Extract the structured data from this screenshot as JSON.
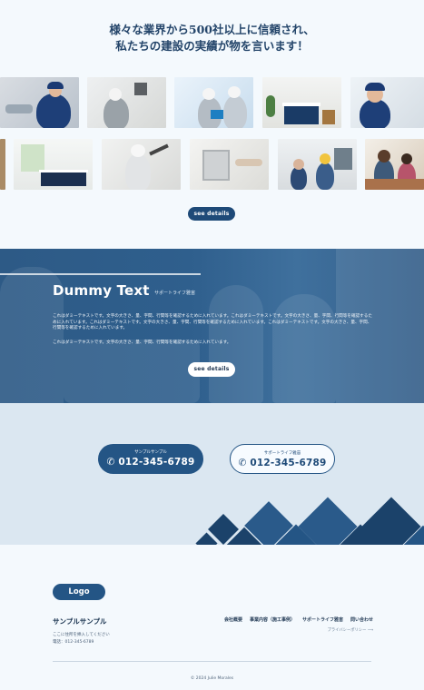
{
  "hero": {
    "headline_line1": "様々な業界から500社以上に信頼され、",
    "headline_line2": "私たちの建設の実績が物を言います！",
    "see_details_label": "see details"
  },
  "band": {
    "title": "Dummy Text",
    "subtitle": "サポートライフ雅宙",
    "paragraph1": "これはダミーテキストです。文字の大きさ、量、字間、行間等を確認するために入れています。これはダミーテキストです。文字の大きさ、量、字間、行間等を確認するために入れています。これはダミーテキストです。文字の大きさ、量、字間、行間等を確認するために入れています。これはダミーテキストです。文字の大きさ、量、字間、行間等を確認するために入れています。",
    "paragraph2": "これはダミーテキストです。文字の大きさ、量、字間、行間等を確認するために入れています。",
    "see_details_label": "see details"
  },
  "phones": {
    "primary": {
      "label": "サンプルサンプル",
      "number": "012-345-6789"
    },
    "secondary": {
      "label": "サポートライフ雅宙",
      "number": "012-345-6789"
    }
  },
  "footer": {
    "logo": "Logo",
    "company_name": "サンプルサンプル",
    "address": "ここに住所を挿入してください",
    "phone": "電話：012-345-6789",
    "nav": [
      "会社概要",
      "事業内容（施工事例）",
      "サポートライフ雅宙",
      "問い合わせ"
    ],
    "privacy": "プライバシーポリシー ⟶",
    "copyright": "© 2024 Julie Morales"
  },
  "colors": {
    "primary": "#245585",
    "band": "#2f5f8d",
    "diamond_dark": "#1b426a",
    "diamond_mid": "#2a5a8a"
  },
  "icons": {
    "phone": "phone-icon",
    "arrow": "arrow-right-icon"
  }
}
